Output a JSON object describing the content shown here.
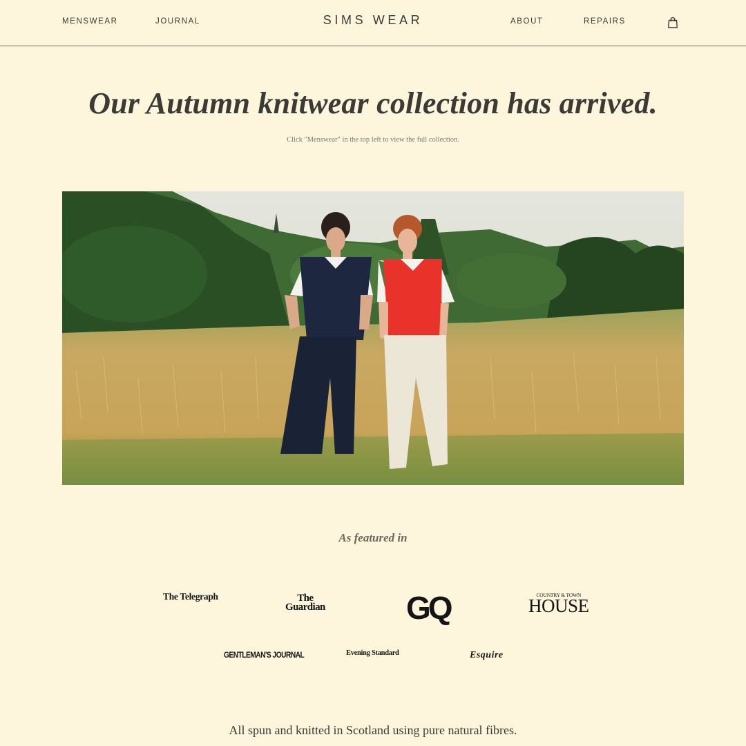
{
  "header": {
    "brand": "SIMS WEAR",
    "nav_left": [
      "MENSWEAR",
      "JOURNAL"
    ],
    "nav_right": [
      "ABOUT",
      "REPAIRS"
    ],
    "cart_icon": "shopping-bag-icon"
  },
  "hero": {
    "headline": "Our Autumn knitwear collection has arrived.",
    "subtext": "Click \"Menswear\" in the top left to view the full collection."
  },
  "photo": {
    "subject": "two-models-in-knit-vests-in-meadow",
    "colors": {
      "sky": "#dfe2d8",
      "trees": "#2f5a2a",
      "grass": "#c8a85a",
      "navy_vest": "#1d2740",
      "red_vest": "#e8322a"
    }
  },
  "featured": {
    "heading": "As featured in",
    "logos": {
      "telegraph": "The Telegraph",
      "guardian_line1": "The",
      "guardian_line2": "Guardian",
      "gq": "GQ",
      "house_small": "COUNTRY & TOWN",
      "house_big": "HOUSE",
      "gentlemans": "GENTLEMAN'S JOURNAL",
      "standard": "Evening Standard",
      "esquire": "Esquire"
    }
  },
  "footer": {
    "tagline": "All spun and knitted in Scotland using pure natural fibres."
  },
  "colors": {
    "background": "#fdf5dc",
    "text": "#3b3a35"
  }
}
